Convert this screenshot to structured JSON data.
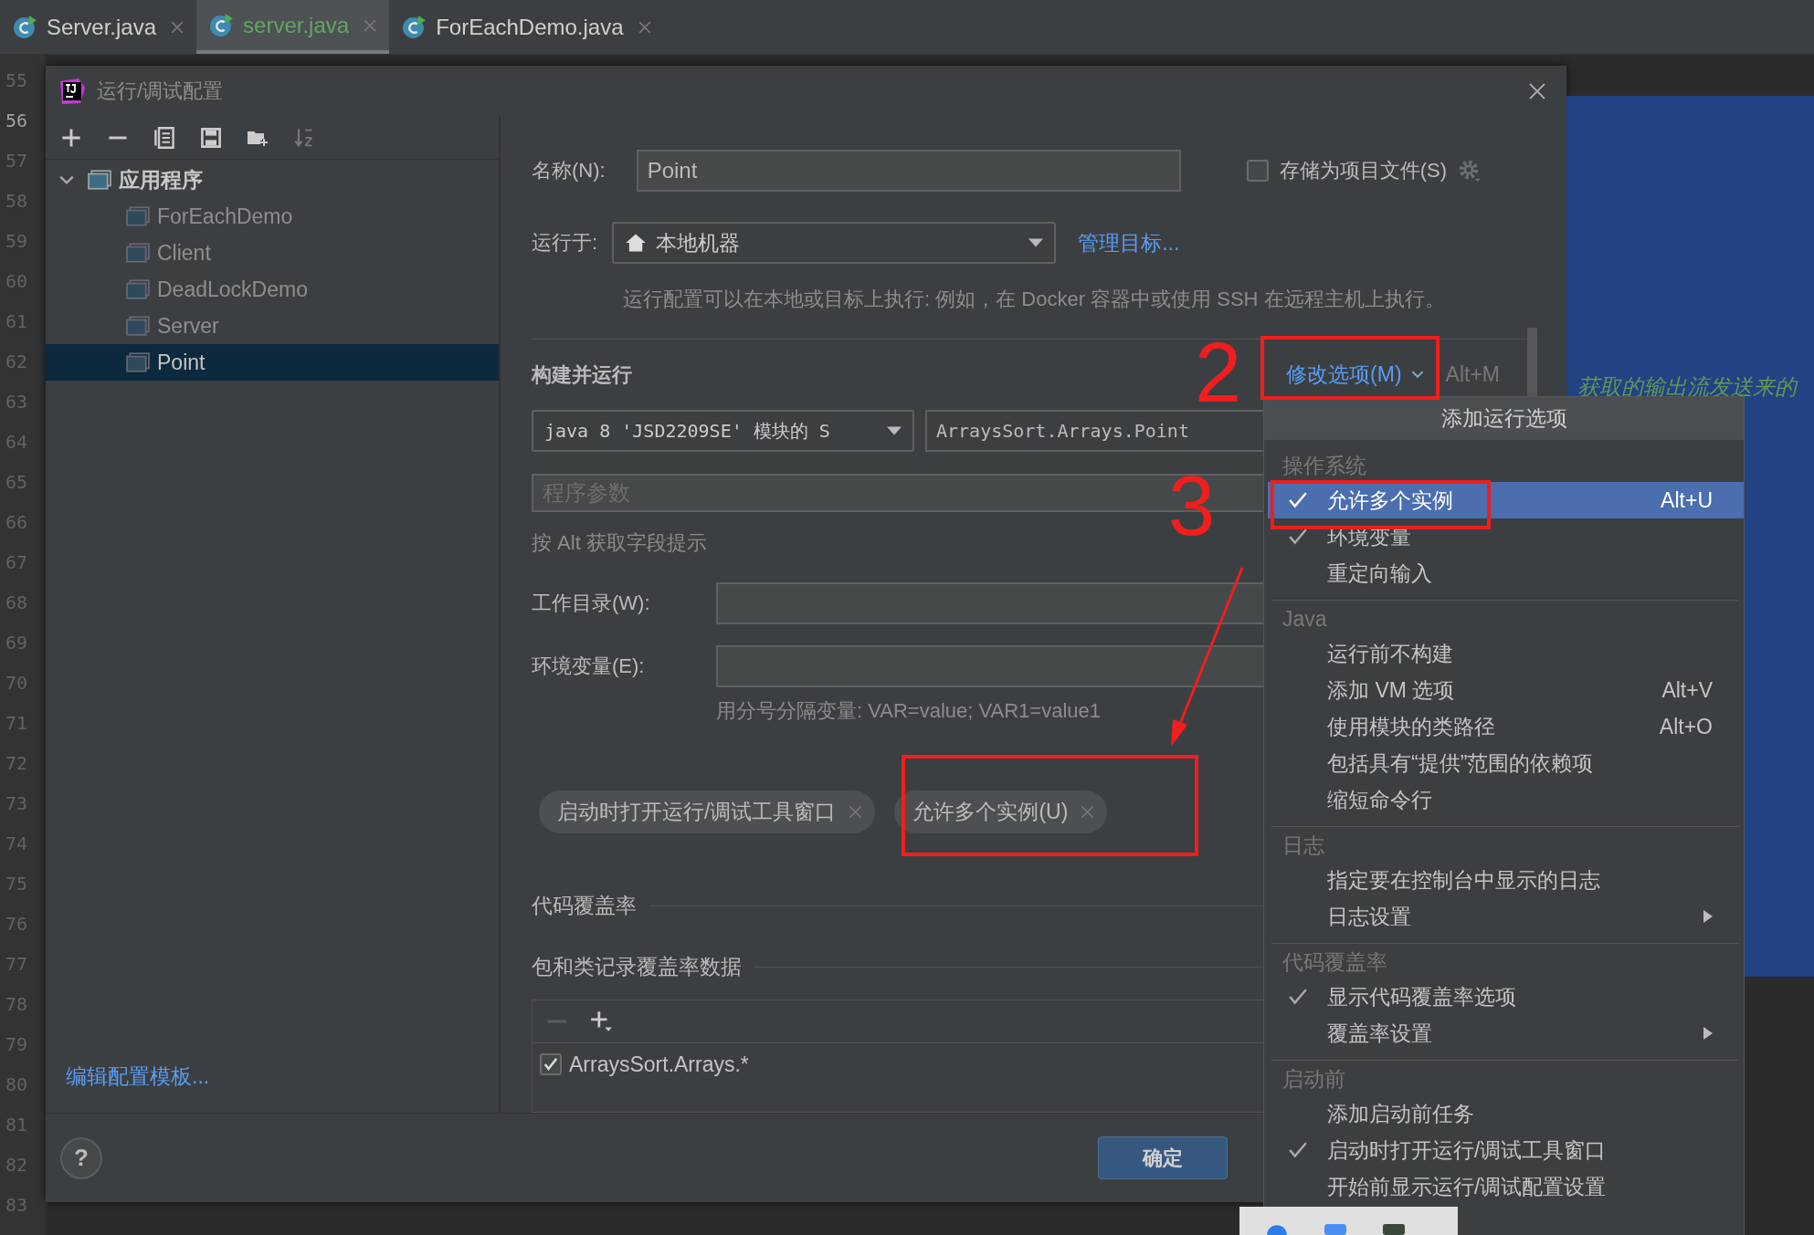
{
  "editor_tabs": [
    {
      "label": "Server.java",
      "selected": false
    },
    {
      "label": "server.java",
      "selected": true
    },
    {
      "label": "ForEachDemo.java",
      "selected": false
    }
  ],
  "line_numbers": [
    {
      "number": "55",
      "current": false
    },
    {
      "number": "56",
      "current": true
    },
    {
      "number": "57",
      "current": false
    },
    {
      "number": "58",
      "current": false
    },
    {
      "number": "59",
      "current": false
    },
    {
      "number": "60",
      "current": false
    },
    {
      "number": "61",
      "current": false
    },
    {
      "number": "62",
      "current": false
    },
    {
      "number": "63",
      "current": false
    },
    {
      "number": "64",
      "current": false
    },
    {
      "number": "65",
      "current": false
    },
    {
      "number": "66",
      "current": false
    },
    {
      "number": "67",
      "current": false
    },
    {
      "number": "68",
      "current": false
    },
    {
      "number": "69",
      "current": false
    },
    {
      "number": "70",
      "current": false
    },
    {
      "number": "71",
      "current": false
    },
    {
      "number": "72",
      "current": false
    },
    {
      "number": "73",
      "current": false
    },
    {
      "number": "74",
      "current": false
    },
    {
      "number": "75",
      "current": false
    },
    {
      "number": "76",
      "current": false
    },
    {
      "number": "77",
      "current": false
    },
    {
      "number": "78",
      "current": false
    },
    {
      "number": "79",
      "current": false
    },
    {
      "number": "80",
      "current": false
    },
    {
      "number": "81",
      "current": false
    },
    {
      "number": "82",
      "current": false
    },
    {
      "number": "83",
      "current": false
    }
  ],
  "editor_comment": "获取的输出流发送来的",
  "dialog": {
    "title": "运行/调试配置",
    "tree": {
      "label": "应用程序",
      "expanded": true,
      "children": [
        {
          "label": "ForEachDemo",
          "selected": false
        },
        {
          "label": "Client",
          "selected": false
        },
        {
          "label": "DeadLockDemo",
          "selected": false
        },
        {
          "label": "Server",
          "selected": false
        },
        {
          "label": "Point",
          "selected": true
        }
      ]
    },
    "edit_templates_link": "编辑配置模板...",
    "name_label": "名称(N):",
    "name_value": "Point",
    "store_checkbox": {
      "label": "存储为项目文件(S)",
      "checked": false
    },
    "run_on_label": "运行于:",
    "run_on_value": "本地机器",
    "manage_targets_link": "管理目标...",
    "run_on_hint": "运行配置可以在本地或目标上执行: 例如，在 Docker 容器中或使用 SSH 在远程主机上执行。",
    "build_run_title": "构建并运行",
    "modify_options": {
      "label": "修改选项(M)",
      "shortcut": "Alt+M"
    },
    "jdk_select": "java 8 'JSD2209SE' 模块的 S",
    "main_class": "ArraysSort.Arrays.Point",
    "program_args_placeholder": "程序参数",
    "alt_hint": "按 Alt 获取字段提示",
    "workdir_label": "工作目录(W):",
    "env_label": "环境变量(E):",
    "env_hint": "用分号分隔变量: VAR=value; VAR1=value1",
    "option_chips": [
      "启动时打开运行/调试工具窗口",
      "允许多个实例(U)"
    ],
    "coverage_title": "代码覆盖率",
    "coverage_subtitle": "包和类记录覆盖率数据",
    "coverage_patterns": [
      {
        "pattern": "ArraysSort.Arrays.*",
        "checked": true
      }
    ],
    "ok_button": "确定",
    "help_button": "?"
  },
  "popup": {
    "title": "添加运行选项",
    "sections": [
      {
        "title": "操作系统",
        "items": [
          {
            "label": "允许多个实例",
            "checked": true,
            "selected": true,
            "shortcut": "Alt+U",
            "submenu": false
          },
          {
            "label": "环境变量",
            "checked": true,
            "selected": false,
            "submenu": false
          },
          {
            "label": "重定向输入",
            "checked": false,
            "selected": false,
            "submenu": false
          }
        ]
      },
      {
        "title": "Java",
        "items": [
          {
            "label": "运行前不构建",
            "checked": false,
            "selected": false,
            "submenu": false
          },
          {
            "label": "添加 VM 选项",
            "checked": false,
            "selected": false,
            "shortcut": "Alt+V",
            "submenu": false
          },
          {
            "label": "使用模块的类路径",
            "checked": false,
            "selected": false,
            "shortcut": "Alt+O",
            "submenu": false
          },
          {
            "label": "包括具有“提供”范围的依赖项",
            "checked": false,
            "selected": false,
            "submenu": false
          },
          {
            "label": "缩短命令行",
            "checked": false,
            "selected": false,
            "submenu": false
          }
        ]
      },
      {
        "title": "日志",
        "items": [
          {
            "label": "指定要在控制台中显示的日志",
            "checked": false,
            "selected": false,
            "submenu": false
          },
          {
            "label": "日志设置",
            "checked": false,
            "selected": false,
            "submenu": true
          }
        ]
      },
      {
        "title": "代码覆盖率",
        "items": [
          {
            "label": "显示代码覆盖率选项",
            "checked": true,
            "selected": false,
            "submenu": false
          },
          {
            "label": "覆盖率设置",
            "checked": false,
            "selected": false,
            "submenu": true
          }
        ]
      },
      {
        "title": "启动前",
        "items": [
          {
            "label": "添加启动前任务",
            "checked": false,
            "selected": false,
            "submenu": false
          },
          {
            "label": "启动时打开运行/调试工具窗口",
            "checked": true,
            "selected": false,
            "submenu": false
          },
          {
            "label": "开始前显示运行/调试配置设置",
            "checked": false,
            "selected": false,
            "submenu": false
          }
        ]
      }
    ]
  },
  "annotations": [
    "2",
    "3"
  ]
}
